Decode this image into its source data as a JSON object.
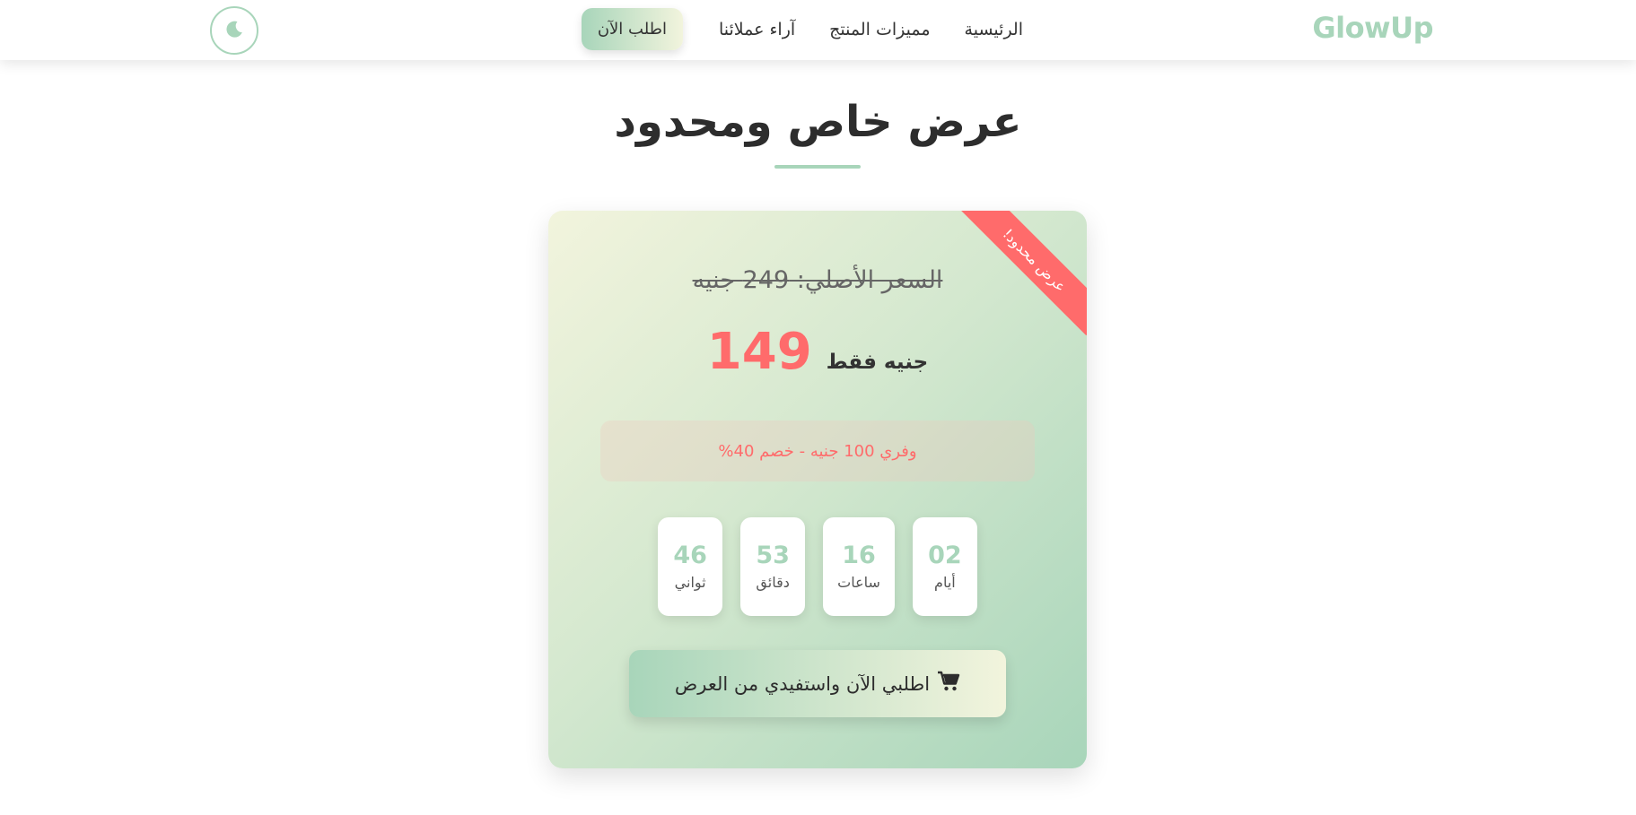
{
  "header": {
    "logo": "GlowUp",
    "nav": {
      "home": "الرئيسية",
      "features": "مميزات المنتج",
      "reviews": "آراء عملائنا",
      "order_now": "اطلب الآن"
    },
    "theme_toggle_icon": "moon-icon"
  },
  "offer": {
    "title": "عرض خاص ومحدود",
    "ribbon": "عرض محدود!",
    "old_price": "السعر الأصلي: 249 جنيه",
    "price": "149",
    "price_suffix": "جنيه فقط",
    "savings": "وفري 100 جنيه - خصم 40%",
    "countdown": [
      {
        "value": "02",
        "label": "أيام"
      },
      {
        "value": "16",
        "label": "ساعات"
      },
      {
        "value": "53",
        "label": "دقائق"
      },
      {
        "value": "46",
        "label": "ثواني"
      }
    ],
    "cta_label": "اطلبي الآن واستفيدي من العرض",
    "cta_icon": "cart-icon"
  },
  "colors": {
    "brand": "#a8d5ba",
    "accent": "#ff6b6b",
    "cream": "#f2f4dd"
  }
}
